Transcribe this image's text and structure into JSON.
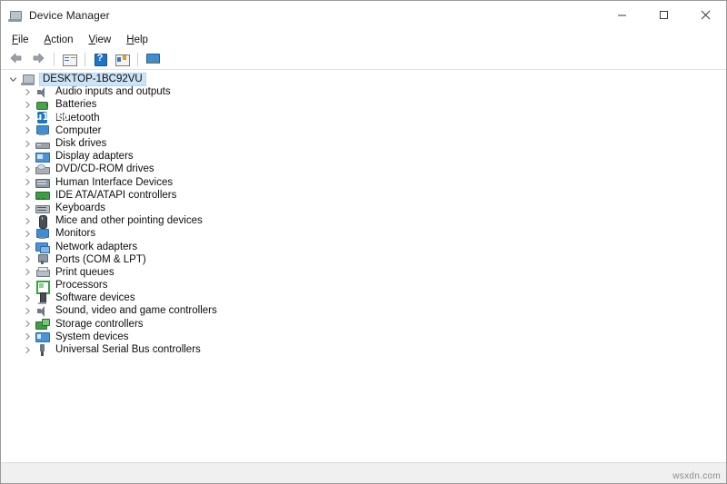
{
  "window": {
    "title": "Device Manager",
    "icon": "computer-icon",
    "controls": {
      "minimize": "—",
      "maximize": "□",
      "close": "✕"
    }
  },
  "menubar": {
    "items": [
      {
        "label": "File",
        "accel": "F"
      },
      {
        "label": "Action",
        "accel": "A"
      },
      {
        "label": "View",
        "accel": "V"
      },
      {
        "label": "Help",
        "accel": "H"
      }
    ]
  },
  "toolbar": {
    "buttons": [
      {
        "name": "back-button",
        "icon": "back-arrow-icon"
      },
      {
        "name": "forward-button",
        "icon": "forward-arrow-icon"
      },
      {
        "name": "properties-button",
        "icon": "properties-icon"
      },
      {
        "name": "help-button",
        "icon": "help-icon"
      },
      {
        "name": "scan-hardware-button",
        "icon": "scan-hardware-changes-icon"
      },
      {
        "name": "show-hide-console-tree-button",
        "icon": "monitor-icon"
      }
    ]
  },
  "tree": {
    "root": {
      "label": "DESKTOP-1BC92VU",
      "icon": "computer-icon",
      "expanded": true,
      "selected": true
    },
    "items": [
      {
        "label": "Audio inputs and outputs",
        "icon": "speaker-icon",
        "icon_class": "ic-speaker"
      },
      {
        "label": "Batteries",
        "icon": "battery-icon",
        "icon_class": "ic-battery"
      },
      {
        "label": "Bluetooth",
        "icon": "bluetooth-icon",
        "icon_class": "ic-bluetooth"
      },
      {
        "label": "Computer",
        "icon": "monitor-icon",
        "icon_class": "ic-monitor"
      },
      {
        "label": "Disk drives",
        "icon": "disk-drive-icon",
        "icon_class": "ic-disk"
      },
      {
        "label": "Display adapters",
        "icon": "display-adapter-icon",
        "icon_class": "ic-display"
      },
      {
        "label": "DVD/CD-ROM drives",
        "icon": "dvd-drive-icon",
        "icon_class": "ic-dvd"
      },
      {
        "label": "Human Interface Devices",
        "icon": "hid-icon",
        "icon_class": "ic-hid"
      },
      {
        "label": "IDE ATA/ATAPI controllers",
        "icon": "ide-controller-icon",
        "icon_class": "ic-ide"
      },
      {
        "label": "Keyboards",
        "icon": "keyboard-icon",
        "icon_class": "ic-keyboard"
      },
      {
        "label": "Mice and other pointing devices",
        "icon": "mouse-icon",
        "icon_class": "ic-mouse"
      },
      {
        "label": "Monitors",
        "icon": "monitor-icon",
        "icon_class": "ic-monitor"
      },
      {
        "label": "Network adapters",
        "icon": "network-adapter-icon",
        "icon_class": "ic-network"
      },
      {
        "label": "Ports (COM & LPT)",
        "icon": "port-icon",
        "icon_class": "ic-port"
      },
      {
        "label": "Print queues",
        "icon": "printer-icon",
        "icon_class": "ic-printer"
      },
      {
        "label": "Processors",
        "icon": "processor-icon",
        "icon_class": "ic-processor"
      },
      {
        "label": "Software devices",
        "icon": "software-device-icon",
        "icon_class": "ic-software"
      },
      {
        "label": "Sound, video and game controllers",
        "icon": "speaker-icon",
        "icon_class": "ic-speaker"
      },
      {
        "label": "Storage controllers",
        "icon": "storage-controller-icon",
        "icon_class": "ic-storage"
      },
      {
        "label": "System devices",
        "icon": "system-device-icon",
        "icon_class": "ic-system"
      },
      {
        "label": "Universal Serial Bus controllers",
        "icon": "usb-controller-icon",
        "icon_class": "ic-usb"
      }
    ],
    "chevron": "❯"
  },
  "statusbar": {
    "watermark": "wsxdn.com"
  },
  "colors": {
    "selection": "#cbe4f7",
    "selection_border": "#b4d8f2",
    "window_border": "#9a9a9a",
    "statusbar_bg": "#f0f0f0",
    "text": "#0d0d0d"
  }
}
